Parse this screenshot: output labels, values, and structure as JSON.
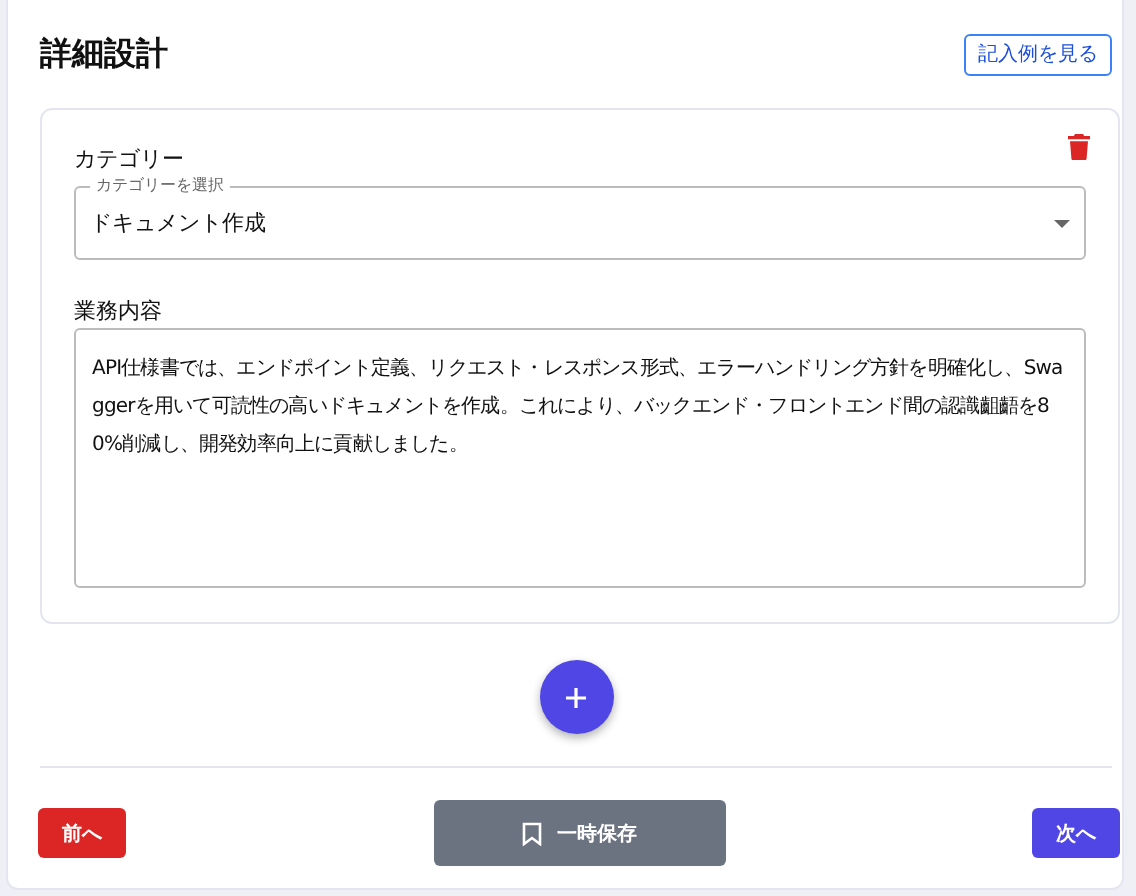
{
  "title": "詳細設計",
  "example_button": "記入例を見る",
  "entry": {
    "category_label": "カテゴリー",
    "select": {
      "floating_label": "カテゴリーを選択",
      "value": "ドキュメント作成"
    },
    "content_label": "業務内容",
    "content_value": "API仕様書では、エンドポイント定義、リクエスト・レスポンス形式、エラーハンドリング方針を明確化し、Swaggerを用いて可読性の高いドキュメントを作成。これにより、バックエンド・フロントエンド間の認識齟齬を80%削減し、開発効率向上に貢献しました。"
  },
  "footer": {
    "prev": "前へ",
    "save": "一時保存",
    "next": "次へ"
  }
}
